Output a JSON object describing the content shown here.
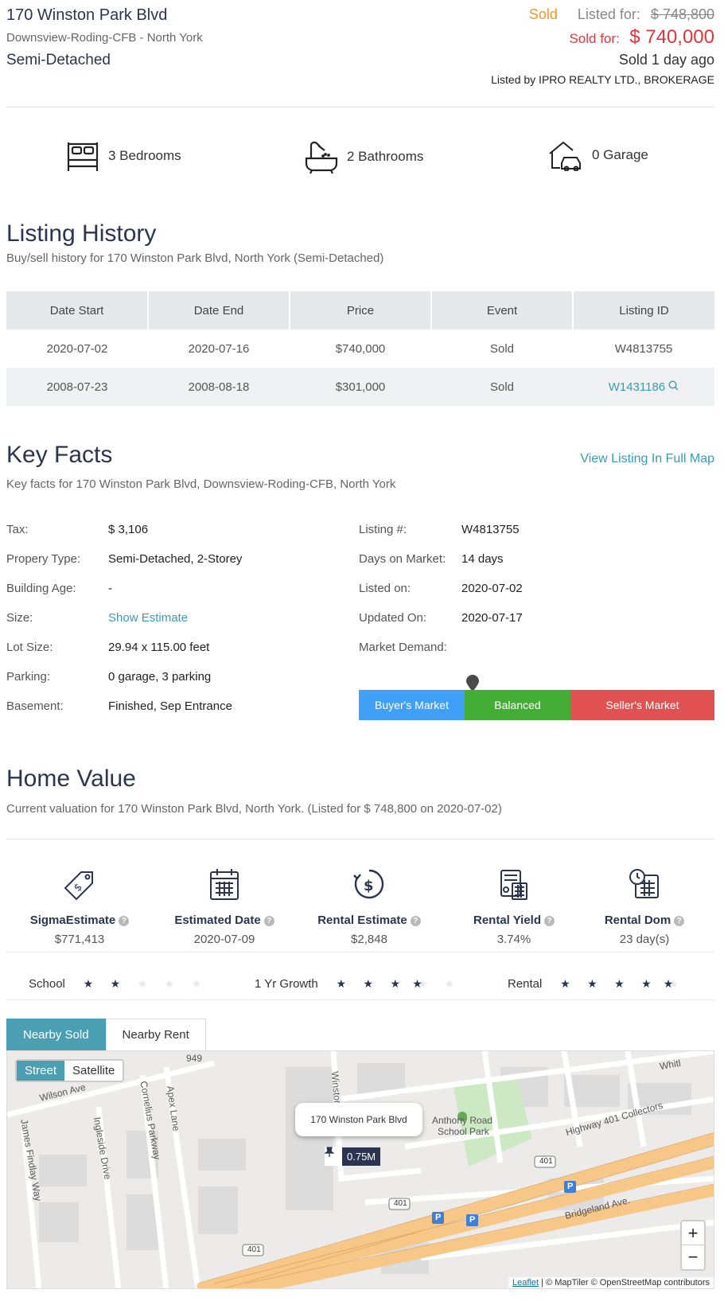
{
  "header": {
    "address": "170 Winston Park Blvd",
    "neighborhood": "Downsview-Roding-CFB - North York",
    "property_type": "Semi-Detached",
    "status": "Sold",
    "listed_for_label": "Listed for:",
    "listed_for_price": "$ 748,800",
    "sold_for_label": "Sold for:",
    "sold_for_price": "$ 740,000",
    "sold_ago": "Sold 1 day ago",
    "listed_by": "Listed by IPRO REALTY LTD., BROKERAGE"
  },
  "features": {
    "bedrooms": "3 Bedrooms",
    "bathrooms": "2 Bathrooms",
    "garage": "0 Garage"
  },
  "history": {
    "title": "Listing History",
    "subtitle": "Buy/sell history for 170 Winston Park Blvd, North York (Semi-Detached)",
    "columns": [
      "Date Start",
      "Date End",
      "Price",
      "Event",
      "Listing ID"
    ],
    "rows": [
      {
        "start": "2020-07-02",
        "end": "2020-07-16",
        "price": "$740,000",
        "event": "Sold",
        "id": "W4813755"
      },
      {
        "start": "2008-07-23",
        "end": "2008-08-18",
        "price": "$301,000",
        "event": "Sold",
        "id": "W1431186"
      }
    ]
  },
  "keyfacts": {
    "title": "Key Facts",
    "subtitle": "Key facts for 170 Winston Park Blvd, Downsview-Roding-CFB, North York",
    "full_map_link": "View Listing In Full Map",
    "left": [
      {
        "label": "Tax:",
        "value": "$ 3,106"
      },
      {
        "label": "Propery Type:",
        "value": "Semi-Detached, 2-Storey"
      },
      {
        "label": "Building Age:",
        "value": "-"
      },
      {
        "label": "Size:",
        "value": "Show Estimate"
      },
      {
        "label": "Lot Size:",
        "value": "29.94 x 115.00 feet"
      },
      {
        "label": "Parking:",
        "value": "0 garage, 3 parking"
      },
      {
        "label": "Basement:",
        "value": "Finished, Sep Entrance"
      }
    ],
    "right": [
      {
        "label": "Listing #:",
        "value": "W4813755"
      },
      {
        "label": "Days on Market:",
        "value": "14 days"
      },
      {
        "label": "Listed on:",
        "value": "2020-07-02"
      },
      {
        "label": "Updated On:",
        "value": "2020-07-17"
      },
      {
        "label": "Market Demand:",
        "value": ""
      }
    ],
    "market": {
      "buyer": "Buyer's Market",
      "balanced": "Balanced",
      "seller": "Seller's Market",
      "position": 0.32
    }
  },
  "homevalue": {
    "title": "Home Value",
    "subtitle": "Current valuation for 170 Winston Park Blvd, North York. (Listed for $ 748,800 on 2020-07-02)",
    "stats": [
      {
        "label": "SigmaEstimate",
        "value": "$771,413",
        "icon": "price-tag-icon"
      },
      {
        "label": "Estimated Date",
        "value": "2020-07-09",
        "icon": "calendar-icon"
      },
      {
        "label": "Rental Estimate",
        "value": "$2,848",
        "icon": "dollar-cycle-icon"
      },
      {
        "label": "Rental Yield",
        "value": "3.74%",
        "icon": "calculator-icon"
      },
      {
        "label": "Rental Dom",
        "value": "23 day(s)",
        "icon": "clock-calendar-icon"
      }
    ],
    "help_glyph": "?",
    "ratings": [
      {
        "label": "School",
        "stars": 2
      },
      {
        "label": "1 Yr Growth",
        "stars": 3.5
      },
      {
        "label": "Rental",
        "stars": 4.5
      }
    ]
  },
  "nearby": {
    "tabs": [
      "Nearby Sold",
      "Nearby Rent"
    ],
    "active_tab": "Nearby Sold"
  },
  "map": {
    "street": "Street",
    "satellite": "Satellite",
    "popup": "170 Winston Park Blvd",
    "marker_price": "0.75M",
    "zoom_in": "+",
    "zoom_out": "−",
    "attribution_link": "Leaflet",
    "attribution_text": " | © MapTiler © OpenStreetMap contributors",
    "labels": {
      "wilson": "Wilson Ave",
      "james": "James Findlay Way",
      "ingleside": "Ingleside Drive",
      "cornelius": "Cornelius Parkway",
      "apex": "Apex Lane",
      "winston": "Winston",
      "park": "Anthony Road",
      "park2": "School Park",
      "hwy": "Highway 401 Collectors",
      "bridgeland": "Bridgeland Ave.",
      "whit": "Whitl",
      "num949": "949",
      "shield1": "401",
      "shield2": "401",
      "shield3": "401",
      "parking": "P"
    }
  }
}
